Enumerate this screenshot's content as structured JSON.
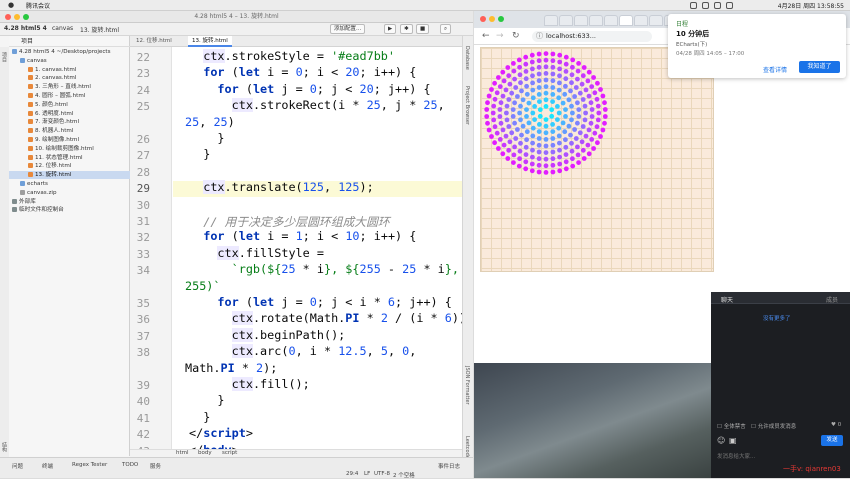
{
  "menubar": {
    "app": "腾讯会议",
    "clock": "4月28日 周四 13:58:55"
  },
  "ide": {
    "title": "4.28 html5 4 – 13. 旋转.html",
    "nav": {
      "crumbs": [
        "4.28 html5 4",
        "canvas",
        "13. 旋转.html"
      ],
      "add_config": "添加配置...",
      "branch": "▸"
    },
    "project": {
      "header": "项目",
      "items": [
        {
          "label": "4.28 html5 4 ~/Desktop/projects",
          "kind": "folder",
          "indent": 0
        },
        {
          "label": "canvas",
          "kind": "folder",
          "indent": 1
        },
        {
          "label": "1. canvas.html",
          "kind": "file",
          "indent": 2
        },
        {
          "label": "2. canvas.html",
          "kind": "file",
          "indent": 2
        },
        {
          "label": "3. 三角形 – 直线.html",
          "kind": "file",
          "indent": 2
        },
        {
          "label": "4. 圆形 – 圆弧.html",
          "kind": "file",
          "indent": 2
        },
        {
          "label": "5. 颜色.html",
          "kind": "file",
          "indent": 2
        },
        {
          "label": "6. 透明度.html",
          "kind": "file",
          "indent": 2
        },
        {
          "label": "7. 渐变颜色.html",
          "kind": "file",
          "indent": 2
        },
        {
          "label": "8. 机器人.html",
          "kind": "file",
          "indent": 2
        },
        {
          "label": "9. 绘制图像.html",
          "kind": "file",
          "indent": 2
        },
        {
          "label": "10. 绘制裁剪图像.html",
          "kind": "file",
          "indent": 2
        },
        {
          "label": "11. 状态管理.html",
          "kind": "file",
          "indent": 2
        },
        {
          "label": "12. 位移.html",
          "kind": "file",
          "indent": 2
        },
        {
          "label": "13. 旋转.html",
          "kind": "file",
          "indent": 2,
          "selected": true
        },
        {
          "label": "echarts",
          "kind": "folder",
          "indent": 1
        },
        {
          "label": "canvas.zip",
          "kind": "zip",
          "indent": 1
        },
        {
          "label": "外部库",
          "kind": "lib",
          "indent": 0
        },
        {
          "label": "临时文件和控制台",
          "kind": "lib",
          "indent": 0
        }
      ]
    },
    "tabs": [
      "12. 位移.html",
      "13. 旋转.html"
    ],
    "lines": [
      {
        "n": "22",
        "html": "<span class=\"hl\">ctx</span>.strokeStyle = <span class=\"str\">'#ead7bb'</span>",
        "indent": "  "
      },
      {
        "n": "23",
        "html": "<span class=\"kw\">for</span> (<span class=\"kw\">let</span> i = <span class=\"num\">0</span>; i &lt; <span class=\"num\">20</span>; i++) {",
        "indent": "  "
      },
      {
        "n": "24",
        "html": "<span class=\"kw\">for</span> (<span class=\"kw\">let</span> j = <span class=\"num\">0</span>; j &lt; <span class=\"num\">20</span>; j++) {",
        "indent": "    "
      },
      {
        "n": "25",
        "html": "<span class=\"hl\">ctx</span>.strokeRect(i * <span class=\"num\">25</span>, j * <span class=\"num\">25</span>,",
        "indent": "      "
      },
      {
        "n": "",
        "html": "<span class=\"num\">25</span>, <span class=\"num\">25</span>)",
        "indent": ""
      },
      {
        "n": "26",
        "html": "}",
        "indent": "    "
      },
      {
        "n": "27",
        "html": "}",
        "indent": "  "
      },
      {
        "n": "28",
        "html": "",
        "indent": ""
      },
      {
        "n": "29",
        "html": "<span class=\"hl\">ctx</span>.translate(<span class=\"num\">125</span>, <span class=\"num\">125</span>);",
        "indent": "  ",
        "current": true
      },
      {
        "n": "30",
        "html": "",
        "indent": ""
      },
      {
        "n": "31",
        "html": "<span class=\"cmt\">// 用于决定多少层圆环组成大圆环</span>",
        "indent": "  "
      },
      {
        "n": "32",
        "html": "<span class=\"kw\">for</span> (<span class=\"kw\">let</span> i = <span class=\"num\">1</span>; i &lt; <span class=\"num\">10</span>; i++) {",
        "indent": "  "
      },
      {
        "n": "33",
        "html": "<span class=\"hl\">ctx</span>.fillStyle =",
        "indent": "    "
      },
      {
        "n": "34",
        "html": "<span class=\"str\">`rgb(${</span><span class=\"num\">25</span> * i<span class=\"str\">}, ${</span><span class=\"num\">255</span> - <span class=\"num\">25</span> * i<span class=\"str\">},</span>",
        "indent": "      "
      },
      {
        "n": "",
        "html": "<span class=\"str\">255)`</span>",
        "indent": ""
      },
      {
        "n": "35",
        "html": "<span class=\"kw\">for</span> (<span class=\"kw\">let</span> j = <span class=\"num\">0</span>; j &lt; i * <span class=\"num\">6</span>; j++) {",
        "indent": "    "
      },
      {
        "n": "36",
        "html": "<span class=\"hl\">ctx</span>.rotate(Math.<span class=\"kw\">PI</span> * <span class=\"num\">2</span> / (i * <span class=\"num\">6</span>));",
        "indent": "      "
      },
      {
        "n": "37",
        "html": "<span class=\"hl\">ctx</span>.beginPath();",
        "indent": "      "
      },
      {
        "n": "38",
        "html": "<span class=\"hl\">ctx</span>.arc(<span class=\"num\">0</span>, i * <span class=\"num\">12.5</span>, <span class=\"num\">5</span>, <span class=\"num\">0</span>,",
        "indent": "      "
      },
      {
        "n": "",
        "html": "Math.<span class=\"kw\">PI</span> * <span class=\"num\">2</span>);",
        "indent": ""
      },
      {
        "n": "39",
        "html": "<span class=\"hl\">ctx</span>.fill();",
        "indent": "      "
      },
      {
        "n": "40",
        "html": "}",
        "indent": "    "
      },
      {
        "n": "41",
        "html": "}",
        "indent": "  "
      },
      {
        "n": "42",
        "html": "&lt;/<span class=\"kw\">script</span>&gt;",
        "indent": ""
      },
      {
        "n": "43",
        "html": "&lt;/<span class=\"kw\">body</span>&gt;",
        "indent": ""
      }
    ],
    "breadcrumbs": [
      "html",
      "body",
      "script"
    ],
    "status": {
      "left": [
        "问题",
        "终端",
        "Regex Tester",
        "TODO",
        "服务"
      ],
      "pos": "29:4",
      "lf": "LF",
      "enc": "UTF-8",
      "indent": "2 个空格",
      "event": "事件日志"
    },
    "strip": {
      "right1": "Database",
      "right2": "Project Browser",
      "right3": "JSON Formatter",
      "right4": "Leetcode",
      "left1": "结构",
      "left2": "收藏夹"
    }
  },
  "browser": {
    "url": "localhost:633...",
    "grid_color": "#ead7bb"
  },
  "notification": {
    "title": "日程",
    "subtitle": "10 分钟后",
    "event": "ECharts(下)",
    "time": "04/28 周四 14:05 – 17:00",
    "detail_btn": "查看详情",
    "ok_btn": "我知道了"
  },
  "chat": {
    "tab1": "聊天",
    "tab2": "成员",
    "msg": "没有更多了",
    "opt1": "全体禁言",
    "opt2": "允许成员发消息",
    "count": "0",
    "send": "发送",
    "placeholder": "发消息给大家...",
    "watermark": "一手v: qianren03"
  }
}
